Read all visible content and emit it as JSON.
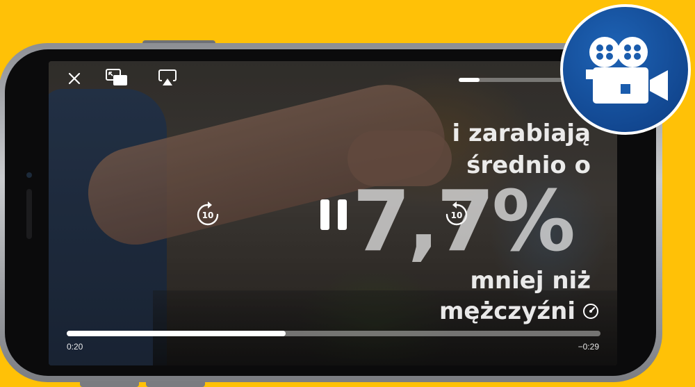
{
  "player": {
    "controls": {
      "close_icon": "close-icon",
      "pip_icon": "picture-in-picture-icon",
      "airplay_icon": "airplay-icon",
      "rewind_seconds": "10",
      "forward_seconds": "10",
      "pause_icon": "pause-icon",
      "speed_icon": "playback-speed-icon"
    },
    "volume_level": 0.2,
    "progress": 0.41,
    "time_elapsed": "0:20",
    "time_remaining": "−0:29"
  },
  "overlay": {
    "line1": "i zarabiają",
    "line2": "średnio o",
    "line3": "7,7%",
    "line4": "mniej niż",
    "line5": "mężczyźni"
  },
  "badge": {
    "icon": "video-camera-icon",
    "color": "#1a5cad"
  },
  "colors": {
    "background": "#ffc107",
    "accent": "#ffffff"
  }
}
